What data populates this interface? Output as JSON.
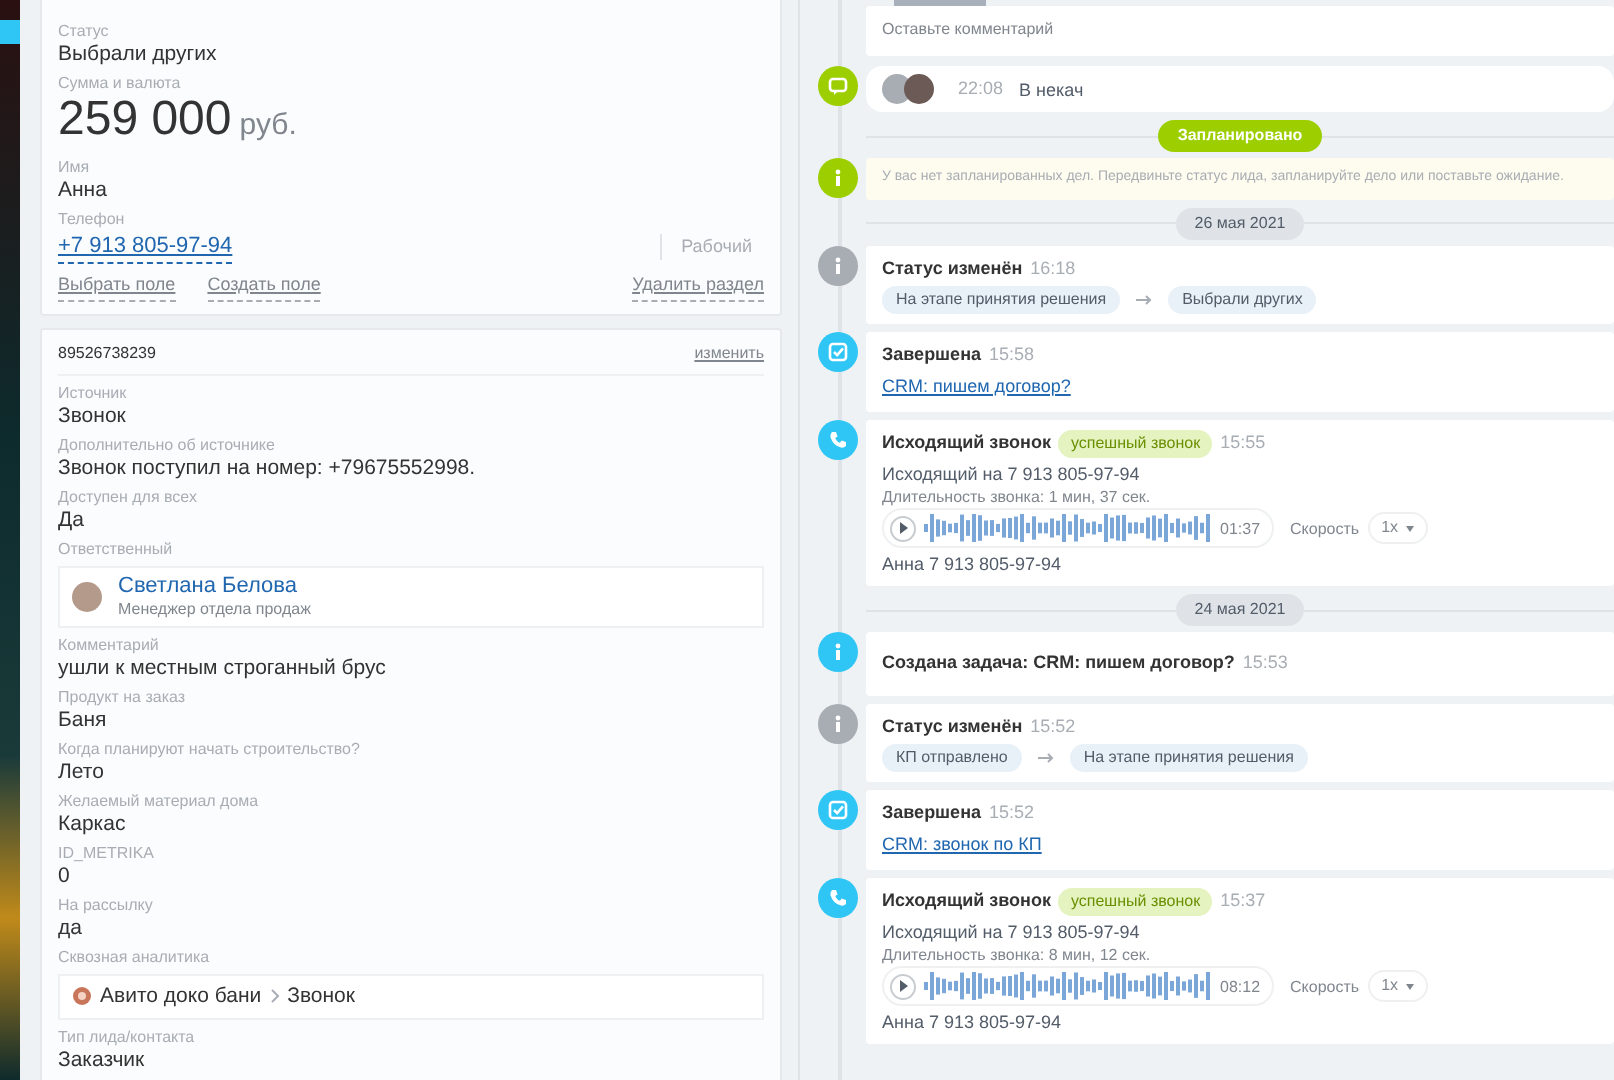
{
  "lead_card": {
    "fields": [
      {
        "kind": "text",
        "label": "Статус",
        "value": "Выбрали других"
      },
      {
        "kind": "money",
        "label": "Сумма и валюта",
        "value": "259 000",
        "currency": "руб."
      },
      {
        "kind": "text",
        "label": "Имя",
        "value": "Анна"
      },
      {
        "kind": "phone",
        "label": "Телефон",
        "value": "+7 913 805-97-94",
        "type": "Рабочий"
      }
    ],
    "links": [
      "Выбрать поле",
      "Создать поле"
    ],
    "delete_link": "Удалить раздел"
  },
  "details_card": {
    "title": "89526738239",
    "edit_link": "изменить",
    "fields": [
      {
        "kind": "text",
        "label": "Источник",
        "value": "Звонок"
      },
      {
        "kind": "text",
        "label": "Дополнительно об источнике",
        "value": "Звонок поступил на номер: +79675552998."
      },
      {
        "kind": "text",
        "label": "Доступен для всех",
        "value": "Да"
      },
      {
        "kind": "user",
        "label": "Ответственный",
        "name": "Светлана Белова",
        "position": "Менеджер отдела продаж"
      },
      {
        "kind": "text",
        "label": "Комментарий",
        "value": "ушли к местным строганный брус"
      },
      {
        "kind": "text",
        "label": "Продукт на заказ",
        "value": "Баня"
      },
      {
        "kind": "text",
        "label": "Когда планируют начать строительство?",
        "value": "Лето"
      },
      {
        "kind": "text",
        "label": "Желаемый материал дома",
        "value": "Каркас"
      },
      {
        "kind": "text",
        "label": "ID_METRIKA",
        "value": "0"
      },
      {
        "kind": "text",
        "label": "На рассылку",
        "value": "да"
      },
      {
        "kind": "analytics",
        "label": "Сквозная аналитика",
        "source": "Авито доко бани",
        "step": "Звонок"
      },
      {
        "kind": "text",
        "label": "Тип лида/контакта",
        "value": "Заказчик"
      }
    ]
  },
  "timeline": [
    {
      "kind": "comment_input",
      "placeholder": "Оставьте комментарий"
    },
    {
      "kind": "comment",
      "time": "22:08",
      "text": "В некач"
    },
    {
      "kind": "planned",
      "label": "Запланировано"
    },
    {
      "kind": "notice",
      "text": "У вас нет запланированных дел. Передвиньте статус лида, запланируйте дело или поставьте ожидание."
    },
    {
      "kind": "date",
      "label": "26 мая 2021"
    },
    {
      "kind": "status",
      "title": "Статус изменён",
      "time": "16:18",
      "from": "На этапе принятия решения",
      "to": "Выбрали других"
    },
    {
      "kind": "task_done",
      "title": "Завершена",
      "time": "15:58",
      "link": "CRM: пишем договор?"
    },
    {
      "kind": "call",
      "title": "Исходящий звонок",
      "badge": "успешный звонок",
      "time": "15:55",
      "number": "Исходящий на 7 913 805-97-94",
      "duration": "Длительность звонка: 1 мин, 37 сек.",
      "record_time": "01:37",
      "speed_label": "Скорость",
      "speed": "1x",
      "contact": "Анна 7 913 805-97-94"
    },
    {
      "kind": "date",
      "label": "24 мая 2021"
    },
    {
      "kind": "task_created",
      "title": "Создана задача: CRM: пишем договор?",
      "time": "15:53"
    },
    {
      "kind": "status",
      "title": "Статус изменён",
      "time": "15:52",
      "from": "КП отправлено",
      "to": "На этапе принятия решения"
    },
    {
      "kind": "task_done",
      "title": "Завершена",
      "time": "15:52",
      "link": "CRM: звонок по КП"
    },
    {
      "kind": "call",
      "title": "Исходящий звонок",
      "badge": "успешный звонок",
      "time": "15:37",
      "number": "Исходящий на 7 913 805-97-94",
      "duration": "Длительность звонка: 8 мин, 12 сек.",
      "record_time": "08:12",
      "speed_label": "Скорость",
      "speed": "1x",
      "contact": "Анна 7 913 805-97-94"
    }
  ]
}
